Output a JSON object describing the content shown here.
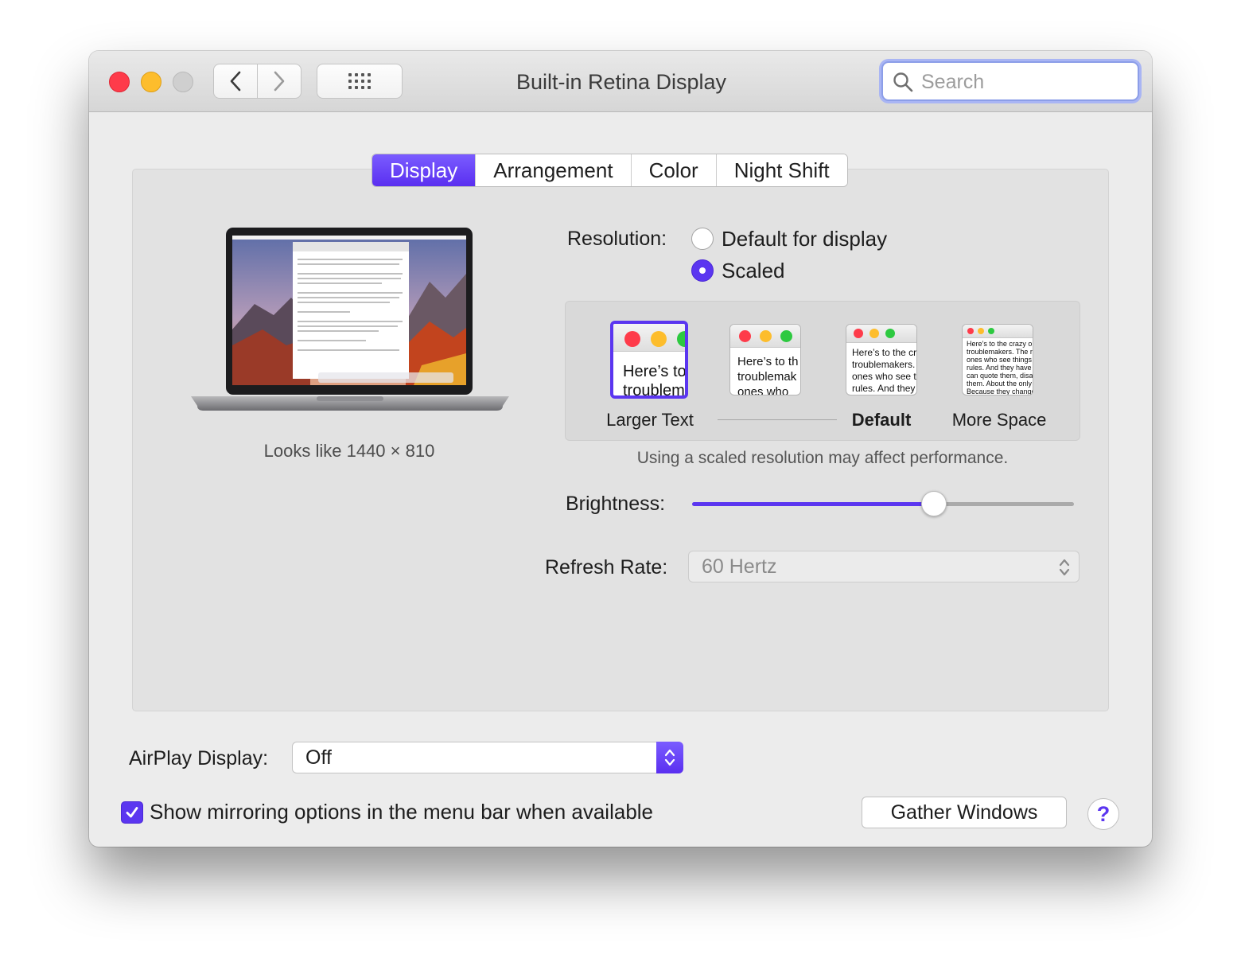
{
  "window": {
    "title": "Built-in Retina Display",
    "search_placeholder": "Search"
  },
  "tabs": [
    {
      "label": "Display",
      "active": true
    },
    {
      "label": "Arrangement",
      "active": false
    },
    {
      "label": "Color",
      "active": false
    },
    {
      "label": "Night Shift",
      "active": false
    }
  ],
  "display_preview": {
    "looks_like": "Looks like 1440 × 810"
  },
  "resolution": {
    "label": "Resolution:",
    "options": [
      {
        "label": "Default for display",
        "selected": false
      },
      {
        "label": "Scaled",
        "selected": true
      }
    ],
    "scales": [
      {
        "label": "Larger Text",
        "sample": "Here’s to\ntroublem",
        "selected": true
      },
      {
        "label": "",
        "sample": "Here’s to th\ntroublemak\nones who",
        "selected": false
      },
      {
        "label": "Default",
        "sample": "Here’s to the cr\ntroublemakers.\nones who see t\nrules. And they",
        "selected": false
      },
      {
        "label": "More Space",
        "sample": "Here’s to the crazy one\ntroublemakers. The rou\nones who see things di\nrules. And they have no\ncan quote them, disagr\nthem. About the only th\nBecause they change t",
        "selected": false
      }
    ],
    "note": "Using a scaled resolution may affect performance."
  },
  "brightness": {
    "label": "Brightness:",
    "value": 0.63
  },
  "refresh_rate": {
    "label": "Refresh Rate:",
    "value": "60 Hertz"
  },
  "airplay": {
    "label": "AirPlay Display:",
    "value": "Off"
  },
  "mirroring": {
    "label": "Show mirroring options in the menu bar when available",
    "checked": true
  },
  "buttons": {
    "gather": "Gather Windows",
    "help": "?"
  },
  "colors": {
    "accent": "#5b36f0",
    "close": "#fe3b4a",
    "minimize": "#fdbd2c",
    "zoom_disabled": "#cfcfcf"
  }
}
